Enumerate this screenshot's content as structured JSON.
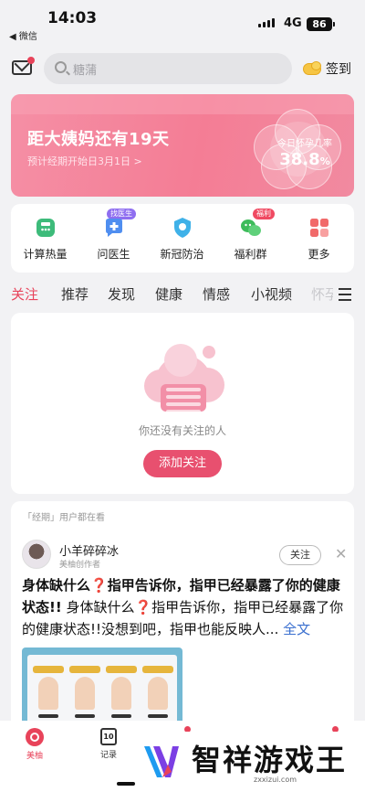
{
  "status": {
    "time": "14:03",
    "back_app": "◀ 微信",
    "network": "4G",
    "battery": "86"
  },
  "topbar": {
    "search_placeholder": "糖蒲",
    "checkin_label": "签到"
  },
  "banner": {
    "title": "距大姨妈还有19天",
    "subtitle": "预计经期开始日3月1日 >",
    "chance_label": "今日怀孕几率",
    "chance_value": "38.8",
    "chance_unit": "%"
  },
  "services": [
    {
      "label": "计算热量",
      "icon": "calculator-icon",
      "badge": ""
    },
    {
      "label": "问医生",
      "icon": "doctor-chat-icon",
      "badge": "找医生"
    },
    {
      "label": "新冠防治",
      "icon": "virus-shield-icon",
      "badge": ""
    },
    {
      "label": "福利群",
      "icon": "group-chat-icon",
      "badge": "福利"
    },
    {
      "label": "更多",
      "icon": "more-grid-icon",
      "badge": ""
    }
  ],
  "tabs": [
    "关注",
    "推荐",
    "发现",
    "健康",
    "情感",
    "小视频",
    "怀孕"
  ],
  "active_tab": "关注",
  "empty_state": {
    "message": "你还没有关注的人",
    "button": "添加关注"
  },
  "feed": {
    "header": "「经期」用户都在看",
    "author_name": "小羊碎碎冰",
    "author_tag": "美柚创作者",
    "follow_label": "关注",
    "close_label": "✕",
    "title_part1": "身体缺什么",
    "title_part2": "指甲告诉你，指甲已经暴露了你的健康状态!!",
    "body_part1": "身体缺什么",
    "body_part2": "指甲告诉你，指甲已经暴露了你的健康状态!!没想到吧，指甲也能反映人...",
    "question_mark": "❓",
    "more_link": "全文"
  },
  "tabbar": [
    {
      "label": "美柚",
      "icon": "meiyou-home-icon",
      "active": true
    },
    {
      "label": "记录",
      "icon": "calendar-record-icon",
      "active": false,
      "icon_text": "10"
    }
  ],
  "watermark": {
    "brand": "智祥游戏王",
    "url": "zxxizui.com"
  },
  "colors": {
    "accent": "#e8435a",
    "banner": "#f47d95",
    "link": "#3a6fcf"
  }
}
